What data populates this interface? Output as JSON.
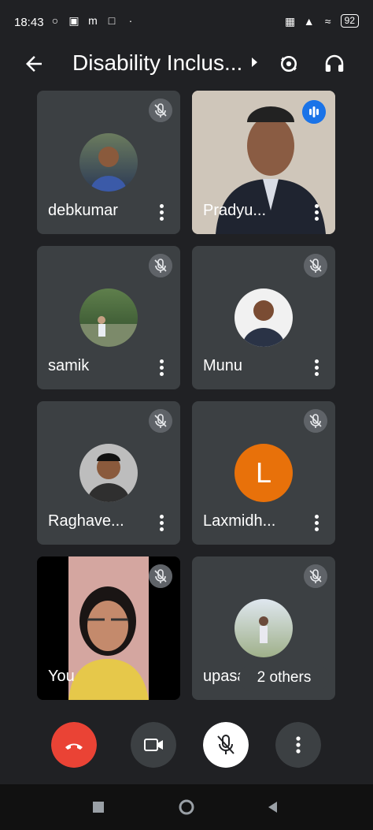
{
  "status_bar": {
    "time": "18:43",
    "battery": "92"
  },
  "header": {
    "title": "Disability Inclus..."
  },
  "participants": [
    {
      "name": "debkumar"
    },
    {
      "name": "Pradyu..."
    },
    {
      "name": "samik"
    },
    {
      "name": "Munu"
    },
    {
      "name": "Raghave..."
    },
    {
      "name": "Laxmidh...",
      "initial": "L"
    },
    {
      "name": "You"
    },
    {
      "name": "upasana"
    }
  ],
  "others_label": "2 others",
  "colors": {
    "end_call": "#ea4335",
    "letter_avatar": "#e8710a",
    "speaking": "#1a73e8"
  }
}
